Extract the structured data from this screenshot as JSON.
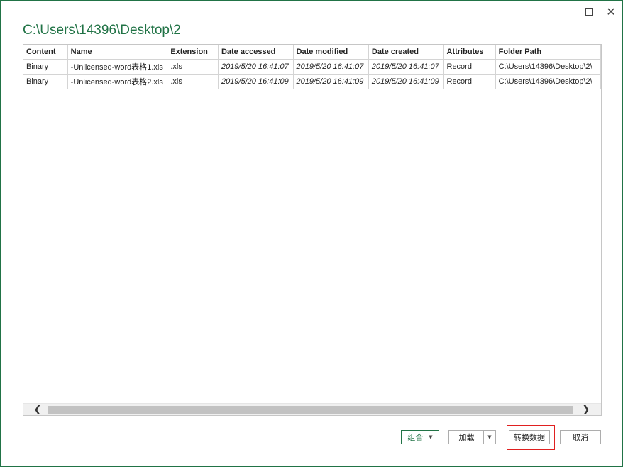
{
  "window": {
    "title": "C:\\Users\\14396\\Desktop\\2",
    "maximize_icon": "maximize-icon",
    "close_glyph": "✕"
  },
  "table": {
    "columns": [
      "Content",
      "Name",
      "Extension",
      "Date accessed",
      "Date modified",
      "Date created",
      "Attributes",
      "Folder Path"
    ],
    "rows": [
      [
        "Binary",
        "-Unlicensed-word表格1.xls",
        ".xls",
        "2019/5/20 16:41:07",
        "2019/5/20 16:41:07",
        "2019/5/20 16:41:07",
        "Record",
        "C:\\Users\\14396\\Desktop\\2\\"
      ],
      [
        "Binary",
        "-Unlicensed-word表格2.xls",
        ".xls",
        "2019/5/20 16:41:09",
        "2019/5/20 16:41:09",
        "2019/5/20 16:41:09",
        "Record",
        "C:\\Users\\14396\\Desktop\\2\\"
      ]
    ]
  },
  "scrollbar": {
    "left_arrow": "❮",
    "right_arrow": "❯"
  },
  "buttons": {
    "combine": "组合",
    "combine_dropdown": "▼",
    "load": "加载",
    "load_dropdown": "▼",
    "transform": "转换数据",
    "cancel": "取消"
  },
  "colors": {
    "accent": "#217346",
    "highlight": "#e02020"
  }
}
